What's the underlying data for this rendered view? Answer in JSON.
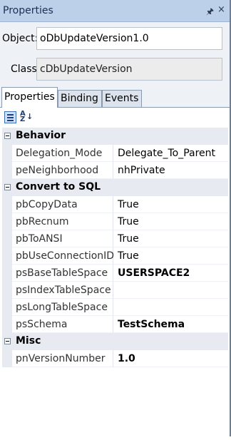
{
  "window": {
    "title": "Properties",
    "pin_glyph": "p",
    "close_glyph": "×"
  },
  "object": {
    "label": "Object:",
    "value": "oDbUpdateVersion1.0"
  },
  "class": {
    "label": "Class",
    "value": "cDbUpdateVersion"
  },
  "tabs": [
    {
      "label": "Properties",
      "active": true
    },
    {
      "label": "Binding",
      "active": false
    },
    {
      "label": "Events",
      "active": false
    }
  ],
  "toolbar": {
    "categorized_icon": "categorized-view-icon",
    "alphabetical_icon": "sort-alphabetical-icon",
    "alpha_glyph_top": "A",
    "alpha_glyph_bottom": "Z"
  },
  "categories": [
    {
      "name": "Behavior",
      "properties": [
        {
          "name": "Delegation_Mode",
          "value": "Delegate_To_Parent",
          "bold": false
        },
        {
          "name": "peNeighborhood",
          "value": "nhPrivate",
          "bold": false
        }
      ]
    },
    {
      "name": "Convert to SQL",
      "properties": [
        {
          "name": "pbCopyData",
          "value": "True",
          "bold": false
        },
        {
          "name": "pbRecnum",
          "value": "True",
          "bold": false
        },
        {
          "name": "pbToANSI",
          "value": "True",
          "bold": false
        },
        {
          "name": "pbUseConnectionID",
          "value": "True",
          "bold": false
        },
        {
          "name": "psBaseTableSpace",
          "value": "USERSPACE2",
          "bold": true
        },
        {
          "name": "psIndexTableSpace",
          "value": "",
          "bold": false
        },
        {
          "name": "psLongTableSpace",
          "value": "",
          "bold": false
        },
        {
          "name": "psSchema",
          "value": "TestSchema",
          "bold": true
        }
      ]
    },
    {
      "name": "Misc",
      "properties": [
        {
          "name": "pnVersionNumber",
          "value": "1.0",
          "bold": true
        }
      ]
    }
  ]
}
